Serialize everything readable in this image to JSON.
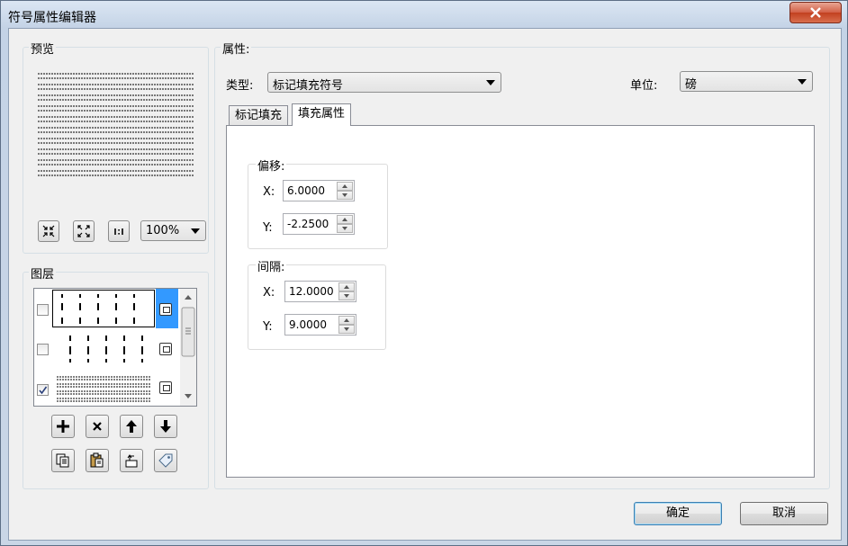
{
  "window": {
    "title": "符号属性编辑器"
  },
  "preview": {
    "label": "预览",
    "zoom": "100%"
  },
  "layers": {
    "label": "图层",
    "items": [
      {
        "checked": false,
        "selected": true,
        "kind": "marker-grid"
      },
      {
        "checked": false,
        "selected": false,
        "kind": "marker-grid-offset"
      },
      {
        "checked": true,
        "selected": false,
        "kind": "line-fill"
      }
    ]
  },
  "properties": {
    "label": "属性:",
    "type_label": "类型:",
    "type_value": "标记填充符号",
    "unit_label": "单位:",
    "unit_value": "磅",
    "tabs": [
      {
        "label": "标记填充"
      },
      {
        "label": "填充属性"
      }
    ],
    "offset": {
      "label": "偏移:",
      "x_label": "X:",
      "x_value": "6.0000",
      "y_label": "Y:",
      "y_value": "-2.2500"
    },
    "spacing": {
      "label": "间隔:",
      "x_label": "X:",
      "x_value": "12.0000",
      "y_label": "Y:",
      "y_value": "9.0000"
    }
  },
  "buttons": {
    "ok": "确定",
    "cancel": "取消"
  }
}
